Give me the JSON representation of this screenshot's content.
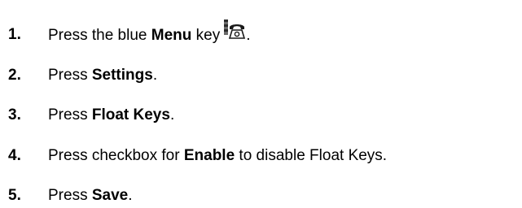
{
  "steps": [
    {
      "number": "1.",
      "before": "Press the blue ",
      "bold": "Menu",
      "after": " key",
      "trailing": ".",
      "icon": "menu-key-phone-icon"
    },
    {
      "number": "2.",
      "before": "Press ",
      "bold": "Settings",
      "after": "."
    },
    {
      "number": "3.",
      "before": "Press ",
      "bold": "Float Keys",
      "after": "."
    },
    {
      "number": "4.",
      "before": "Press checkbox for ",
      "bold": "Enable",
      "after": " to disable Float Keys."
    },
    {
      "number": "5.",
      "before": "Press ",
      "bold": "Save",
      "after": "."
    }
  ]
}
